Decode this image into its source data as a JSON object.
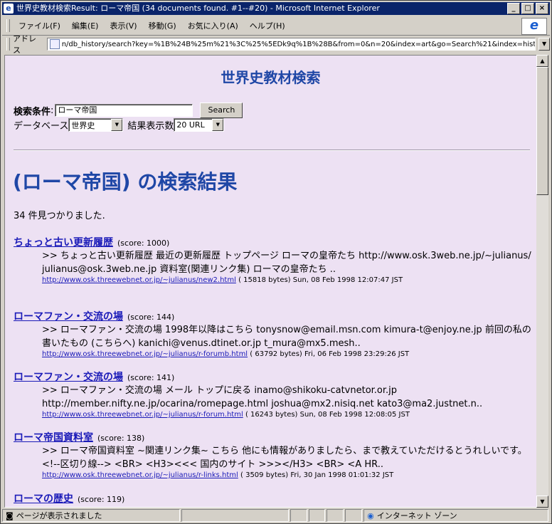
{
  "window": {
    "title": "世界史教材検索Result: ローマ帝国 (34 documents found. #1--#20) - Microsoft Internet Explorer",
    "min_label": "_",
    "max_label": "□",
    "close_label": "×"
  },
  "menu": [
    "ファイル(F)",
    "編集(E)",
    "表示(V)",
    "移動(G)",
    "お気に入り(A)",
    "ヘルプ(H)"
  ],
  "ie_logo": "e",
  "address": {
    "label": "アドレス",
    "url": "n/db_history/search?key=%1B%24B%25m%21%3C%25%5EDk9q%1B%28B&from=0&n=20&index=art&go=Search%21&index=history&n=20"
  },
  "page": {
    "title": "世界史教材検索",
    "query_label": "検索条件",
    "query_value": "ローマ帝国",
    "search_button": "Search",
    "db_label": "データベース",
    "db_value": "世界史",
    "results_label": "結果表示数",
    "results_value": "20 URL",
    "heading": "(ローマ帝国) の検索結果",
    "count_text": "34 件見つかりました."
  },
  "results": [
    {
      "title": "ちょっと古い更新履歴",
      "score": "(score: 1000)",
      "body": ">> ちょっと古い更新履歴 最近の更新履歴 トップページ ローマの皇帝たち http://www.osk.3web.ne.jp/~julianus/ julianus@osk.3web.ne.jp 資料室(関連リンク集) ローマの皇帝たち ..",
      "url": "http://www.osk.threewebnet.or.jp/~julianus/new2.html",
      "meta": "( 15818 bytes) Sun, 08 Feb 1998 12:07:47 JST"
    },
    {
      "title": "ローマファン・交流の場",
      "score": "(score: 144)",
      "body": ">> ローマファン・交流の場 1998年以降はこちら tonysnow@email.msn.com kimura-t@enjoy.ne.jp 前回の私の書いたもの (こちらへ) kanichi@venus.dtinet.or.jp t_mura@mx5.mesh..",
      "url": "http://www.osk.threewebnet.or.jp/~julianus/r-forumb.html",
      "meta": "( 63792 bytes) Fri, 06 Feb 1998 23:29:26 JST"
    },
    {
      "title": "ローマファン・交流の場",
      "score": "(score: 141)",
      "body": ">> ローマファン・交流の場 メール トップに戻る inamo@shikoku-catvnetor.or.jp http://member.nifty.ne.jp/ocarina/romepage.html joshua@mx2.nisiq.net kato3@ma2.justnet.n..",
      "url": "http://www.osk.threewebnet.or.jp/~julianus/r-forum.html",
      "meta": "( 16243 bytes) Sun, 08 Feb 1998 12:08:05 JST"
    },
    {
      "title": "ローマ帝国資料室",
      "score": "(score: 138)",
      "body": ">> ローマ帝国資料室 ~関連リンク集~ こちら 他にも情報がありましたら、まで教えていただけるとうれしいです。 <!--区切り線--> <BR> <H3><<< 国内のサイト >>></H3> <BR> <A HR..",
      "url": "http://www.osk.threewebnet.or.jp/~julianus/r-links.html",
      "meta": "( 3509 bytes) Fri, 30 Jan 1998 01:01:32 JST"
    },
    {
      "title": "ローマの歴史",
      "score": "(score: 119)"
    }
  ],
  "status": {
    "text": "ページが表示されました",
    "zone": "インターネット ゾーン"
  }
}
